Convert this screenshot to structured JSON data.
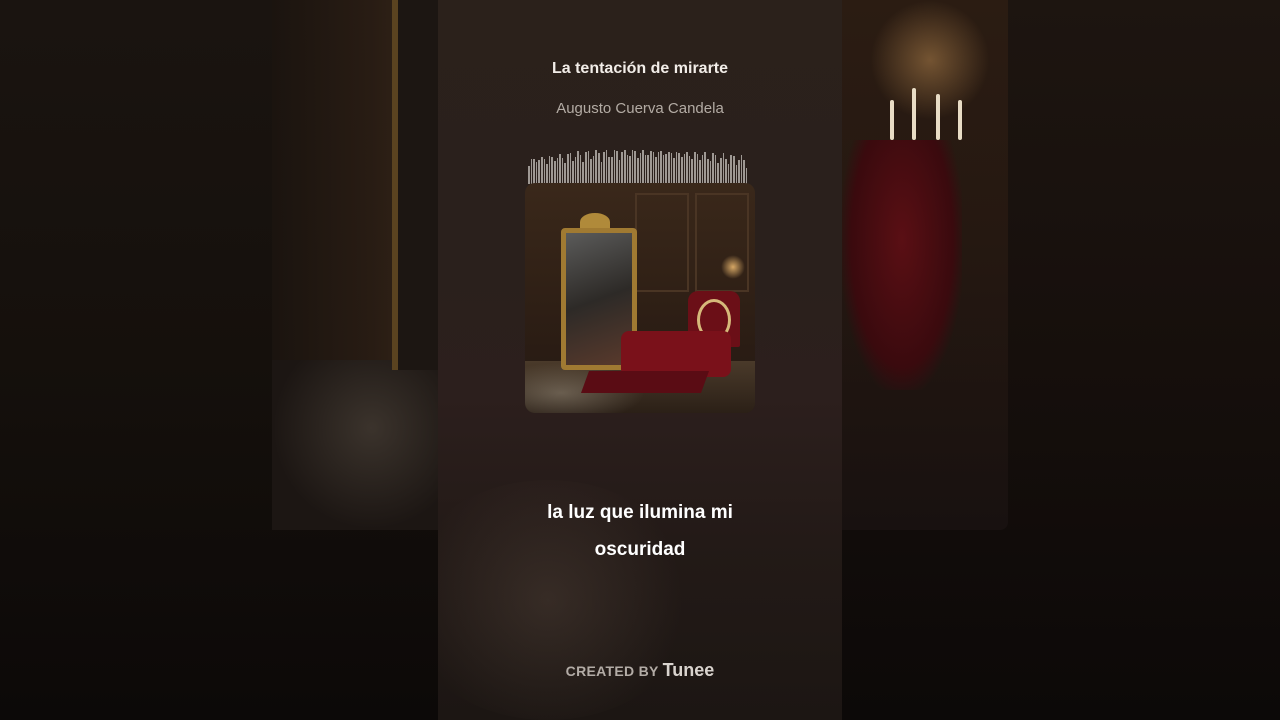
{
  "track": {
    "title": "La tentación de mirarte",
    "artist": "Augusto Cuerva Candela"
  },
  "lyrics": {
    "line1": "la luz que ilumina mi",
    "line2": "oscuridad"
  },
  "credit": {
    "lead": "CREATED BY",
    "brand": "Tunee"
  },
  "colors": {
    "accent_red": "#7a111a",
    "gold": "#a07a32"
  }
}
